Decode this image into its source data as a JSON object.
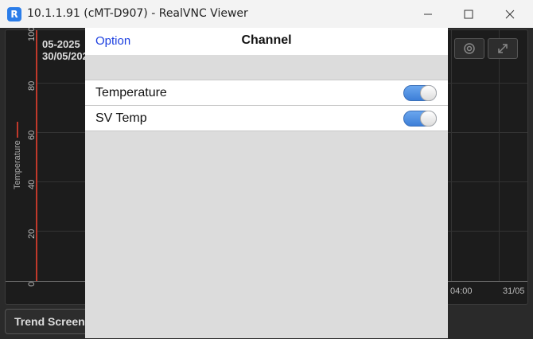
{
  "window": {
    "title": "10.1.1.91 (cMT-D907) - RealVNC Viewer",
    "app_icon_glyph": "R"
  },
  "trend": {
    "date_line1": "05-2025",
    "date_line2": "30/05/202",
    "y_label": "Temperature",
    "y_ticks": [
      "100",
      "80",
      "60",
      "40",
      "20",
      "0"
    ],
    "x_ticks": [
      "04:00",
      "31/05"
    ],
    "trend_button_label": "Trend Screen",
    "series_color": "#c0392b",
    "icons": [
      "gear-icon",
      "expand-icon"
    ]
  },
  "dialog": {
    "option_label": "Option",
    "title": "Channel",
    "channels": [
      {
        "label": "Temperature",
        "enabled": true
      },
      {
        "label": "SV Temp",
        "enabled": true
      }
    ],
    "toggle_color": "#4a8be0"
  }
}
